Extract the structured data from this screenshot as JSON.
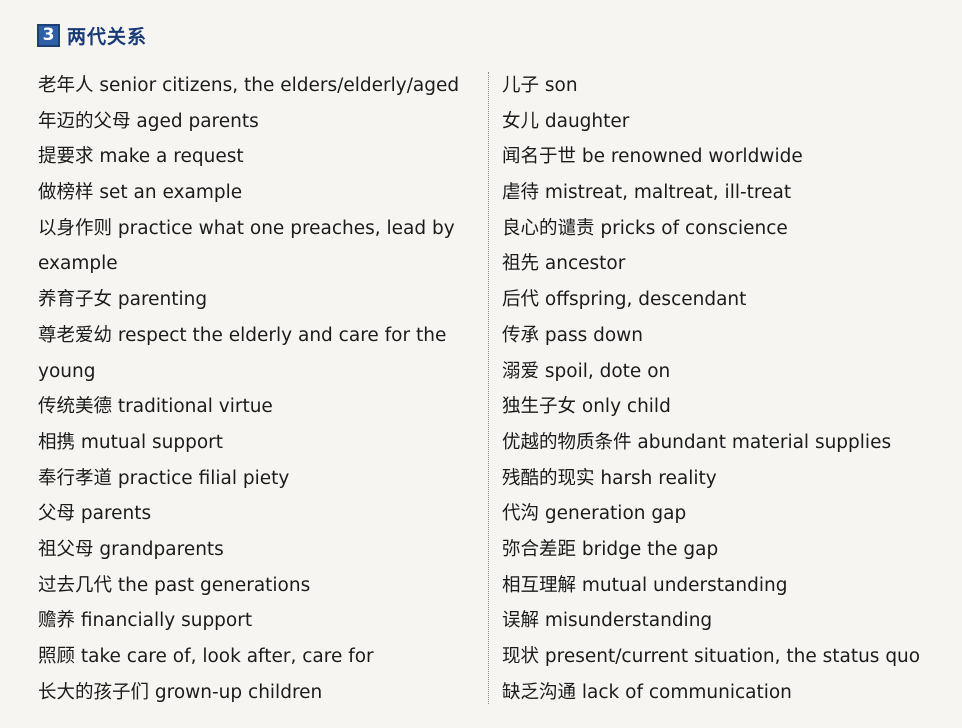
{
  "header": {
    "number": "3",
    "title": "两代关系"
  },
  "left_column": [
    "老年人 senior citizens, the elders/elderly/aged",
    "年迈的父母 aged parents",
    "提要求 make a request",
    "做榜样 set an example",
    "以身作则 practice what one preaches, lead by",
    "example",
    "养育子女 parenting",
    "尊老爱幼 respect the elderly and care for the",
    "young",
    "传统美德 traditional virtue",
    "相携 mutual support",
    "奉行孝道 practice filial piety",
    "父母 parents",
    "祖父母 grandparents",
    "过去几代 the past generations",
    "赡养 financially support",
    "照顾 take care of, look after, care for",
    "长大的孩子们 grown-up children"
  ],
  "right_column": [
    "儿子 son",
    "女儿 daughter",
    "闻名于世 be renowned worldwide",
    "虐待 mistreat, maltreat, ill-treat",
    "良心的谴责 pricks of conscience",
    "祖先 ancestor",
    "后代 offspring, descendant",
    "传承 pass down",
    "溺爱 spoil, dote on",
    "独生子女 only child",
    "优越的物质条件 abundant material supplies",
    "残酷的现实 harsh reality",
    "代沟 generation gap",
    "弥合差距 bridge the gap",
    "相互理解 mutual understanding",
    "误解 misunderstanding",
    "现状 present/current situation, the status quo",
    "缺乏沟通 lack of communication"
  ]
}
